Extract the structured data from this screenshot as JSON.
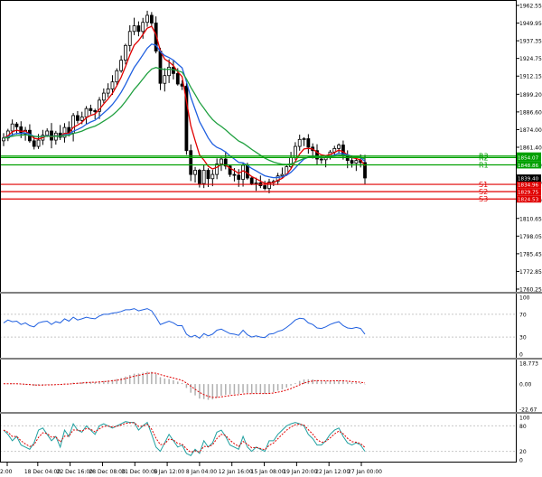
{
  "chart_data": {
    "type": "candlestick",
    "x_labels": [
      "2:00",
      "18 Dec 04:00",
      "22 Dec 16:00",
      "28 Dec 08:00",
      "31 Dec 00:00",
      "5 Jan 12:00",
      "8 Jan 04:00",
      "12 Jan 16:00",
      "15 Jan 08:00",
      "19 Jan 20:00",
      "22 Jan 12:00",
      "27 Jan 00:00"
    ],
    "price_ticks": [
      "1962.55",
      "1949.95",
      "1937.35",
      "1924.75",
      "1912.15",
      "1899.20",
      "1886.60",
      "1874.00",
      "1861.40",
      "1848.80",
      "1836.20",
      "1823.60",
      "1810.65",
      "1798.05",
      "1785.45",
      "1772.85",
      "1760.25"
    ],
    "ylim": [
      1760.25,
      1962.55
    ],
    "close_series": [
      1868.0,
      1873.0,
      1878.0,
      1876.0,
      1871.0,
      1873.5,
      1866.0,
      1862.0,
      1866.5,
      1870.0,
      1873.0,
      1866.5,
      1871.5,
      1868.5,
      1875.5,
      1871.5,
      1884.0,
      1880.5,
      1883.0,
      1889.0,
      1887.5,
      1887.0,
      1895.0,
      1900.0,
      1903.0,
      1908.0,
      1916.0,
      1923.5,
      1934.0,
      1944.0,
      1948.0,
      1944.0,
      1950.5,
      1955.5,
      1950.0,
      1930.0,
      1907.0,
      1912.5,
      1918.5,
      1914.0,
      1906.5,
      1905.0,
      1859.0,
      1842.0,
      1845.0,
      1835.5,
      1845.0,
      1839.0,
      1842.0,
      1849.5,
      1853.0,
      1848.0,
      1842.0,
      1841.5,
      1838.5,
      1848.5,
      1839.5,
      1835.5,
      1836.0,
      1834.0,
      1832.0,
      1836.5,
      1837.0,
      1841.0,
      1842.0,
      1847.5,
      1854.0,
      1862.0,
      1867.0,
      1867.5,
      1861.5,
      1859.0,
      1853.0,
      1852.5,
      1854.0,
      1858.0,
      1860.5,
      1863.0,
      1855.5,
      1852.0,
      1850.0,
      1852.0,
      1850.5,
      1839.5
    ],
    "levels": [
      {
        "name": "R3",
        "value": 1855.15,
        "color": "#00a000"
      },
      {
        "name": "R2",
        "value": 1854.07,
        "color": "#00a000"
      },
      {
        "name": "R1",
        "value": 1848.86,
        "color": "#00a000"
      },
      {
        "name": "S1",
        "value": 1834.96,
        "color": "#e00000"
      },
      {
        "name": "S2",
        "value": 1829.75,
        "color": "#e00000"
      },
      {
        "name": "S3",
        "value": 1824.53,
        "color": "#e00000"
      }
    ],
    "level_labels": {
      "R3": "1855.15",
      "R2": "1854.07",
      "R1": "1848.86",
      "S1": "1834.96",
      "S2": "1829.75",
      "S3": "1824.53"
    },
    "current_price": {
      "value": 1839.4,
      "label": "1839.40",
      "color": "#000000"
    },
    "moving_averages": [
      {
        "color": "#e00000",
        "style": "fast"
      },
      {
        "color": "#2060e0",
        "style": "medium"
      },
      {
        "color": "#20a040",
        "style": "slow"
      }
    ],
    "indicator1": {
      "ticks": [
        "100",
        "70",
        "30",
        "0"
      ],
      "ylim": [
        0,
        100
      ],
      "color": "#2060e0",
      "values": [
        55,
        60,
        57,
        58,
        52,
        55,
        50,
        48,
        55,
        57,
        58,
        52,
        57,
        55,
        62,
        58,
        65,
        60,
        62,
        65,
        63,
        62,
        67,
        70,
        70,
        72,
        73,
        75,
        78,
        78,
        80,
        76,
        78,
        80,
        76,
        65,
        52,
        55,
        58,
        55,
        50,
        50,
        35,
        30,
        33,
        28,
        36,
        32,
        35,
        42,
        44,
        40,
        36,
        35,
        33,
        42,
        34,
        30,
        32,
        30,
        29,
        35,
        36,
        40,
        42,
        47,
        53,
        60,
        63,
        62,
        55,
        52,
        46,
        45,
        48,
        52,
        55,
        57,
        50,
        46,
        45,
        47,
        45,
        35
      ]
    },
    "indicator2": {
      "ticks": [
        "18.773",
        "0.00",
        "-22.67"
      ],
      "ylim": [
        -22.67,
        18.773
      ],
      "color": "#e00000",
      "values": [
        0.3,
        0.4,
        0.4,
        0.1,
        -0.4,
        -0.5,
        -1.0,
        -1.6,
        -1.4,
        -0.9,
        -0.3,
        -0.6,
        -0.1,
        -0.2,
        0.5,
        0.2,
        1.2,
        1.2,
        1.5,
        2.1,
        2.0,
        1.8,
        2.3,
        2.8,
        3.2,
        3.7,
        4.5,
        5.4,
        6.7,
        8.1,
        9.3,
        9.5,
        10.2,
        11.1,
        11.0,
        9.2,
        6.2,
        5.0,
        4.5,
        3.5,
        2.2,
        1.0,
        -3.5,
        -7.8,
        -10.2,
        -13.1,
        -13.5,
        -14.2,
        -13.8,
        -12.3,
        -10.5,
        -9.7,
        -9.3,
        -9.0,
        -8.9,
        -7.8,
        -8.0,
        -8.5,
        -8.4,
        -8.6,
        -8.8,
        -8.0,
        -7.2,
        -6.0,
        -4.8,
        -3.2,
        -1.4,
        0.8,
        2.8,
        4.1,
        4.3,
        4.2,
        3.5,
        2.9,
        2.7,
        2.8,
        3.0,
        3.3,
        2.6,
        2.0,
        1.5,
        1.3,
        1.0,
        -0.3
      ]
    },
    "indicator3": {
      "ticks": [
        "100",
        "80",
        "20",
        "0"
      ],
      "ylim": [
        0,
        100
      ],
      "colors": [
        "#20a0a0",
        "#e00000"
      ],
      "values": [
        70,
        60,
        45,
        55,
        35,
        30,
        25,
        40,
        70,
        75,
        60,
        45,
        55,
        30,
        70,
        55,
        85,
        70,
        65,
        80,
        70,
        60,
        80,
        85,
        80,
        75,
        80,
        85,
        90,
        88,
        88,
        70,
        80,
        88,
        60,
        30,
        20,
        40,
        60,
        45,
        30,
        35,
        15,
        10,
        25,
        15,
        45,
        30,
        40,
        65,
        70,
        55,
        35,
        30,
        25,
        55,
        30,
        20,
        30,
        25,
        20,
        45,
        45,
        60,
        70,
        80,
        85,
        88,
        85,
        80,
        60,
        50,
        35,
        35,
        45,
        60,
        70,
        75,
        55,
        40,
        35,
        40,
        35,
        20
      ]
    }
  }
}
